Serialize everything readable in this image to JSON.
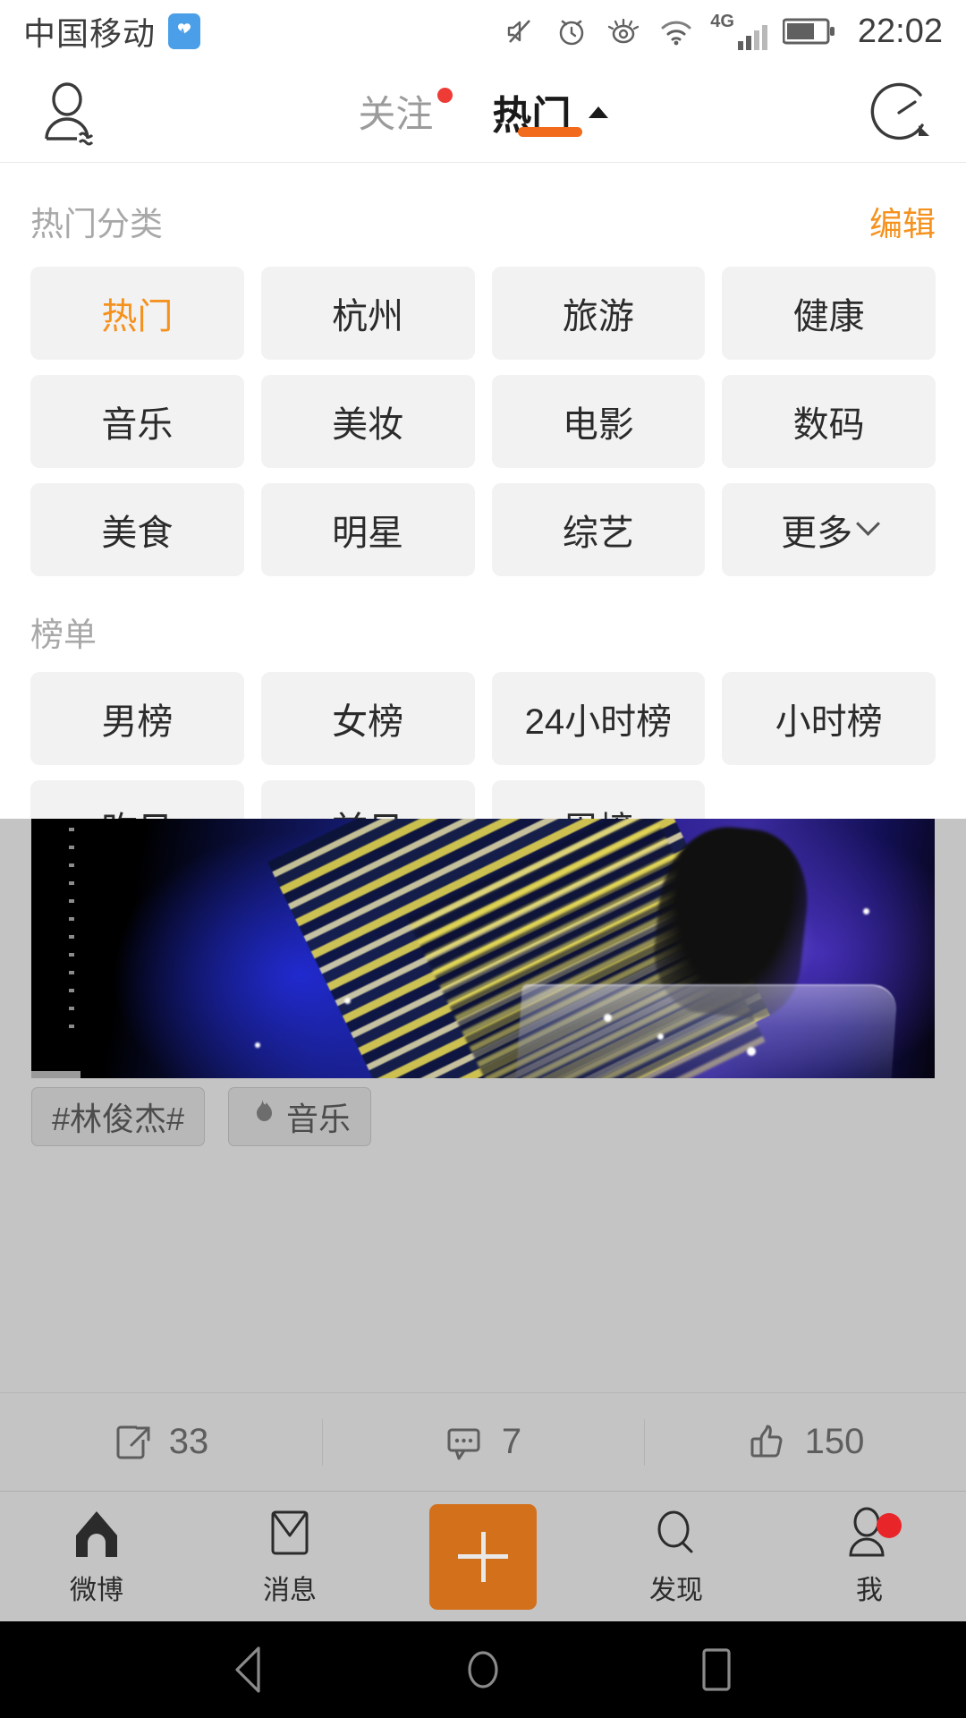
{
  "status_bar": {
    "carrier": "中国移动",
    "time": "22:02",
    "network_label": "4G",
    "icons": [
      "health-monitor-icon",
      "mute-icon",
      "alarm-clock-icon",
      "eye-comfort-icon",
      "wifi-icon",
      "signal-bars-icon",
      "battery-icon"
    ]
  },
  "top_nav": {
    "profile_icon": "user-profile-icon",
    "tabs": [
      {
        "label": "关注",
        "active": false,
        "has_dot": true
      },
      {
        "label": "热门",
        "active": true,
        "has_dot": false
      }
    ],
    "history_icon": "clock-history-icon"
  },
  "panel": {
    "category_section": {
      "title": "热门分类",
      "edit_label": "编辑",
      "chips": [
        {
          "label": "热门",
          "selected": true
        },
        {
          "label": "杭州",
          "selected": false
        },
        {
          "label": "旅游",
          "selected": false
        },
        {
          "label": "健康",
          "selected": false
        },
        {
          "label": "音乐",
          "selected": false
        },
        {
          "label": "美妆",
          "selected": false
        },
        {
          "label": "电影",
          "selected": false
        },
        {
          "label": "数码",
          "selected": false
        },
        {
          "label": "美食",
          "selected": false
        },
        {
          "label": "明星",
          "selected": false
        },
        {
          "label": "综艺",
          "selected": false
        },
        {
          "label": "更多",
          "selected": false,
          "chevron": true
        }
      ]
    },
    "ranking_section": {
      "title": "榜单",
      "chips": [
        {
          "label": "男榜"
        },
        {
          "label": "女榜"
        },
        {
          "label": "24小时榜"
        },
        {
          "label": "小时榜"
        },
        {
          "label": "昨日"
        },
        {
          "label": "前日"
        },
        {
          "label": "周榜"
        }
      ]
    }
  },
  "feed_post": {
    "tags": [
      {
        "label": "#林俊杰#",
        "icon": null
      },
      {
        "label": "音乐",
        "icon": "flame-icon"
      }
    ],
    "actions": [
      {
        "name": "repost",
        "icon": "repost-icon",
        "count": "33"
      },
      {
        "name": "comment",
        "icon": "comment-icon",
        "count": "7"
      },
      {
        "name": "like",
        "icon": "thumbs-up-icon",
        "count": "150"
      }
    ]
  },
  "tab_bar": {
    "items": [
      {
        "label": "微博",
        "icon": "home-icon"
      },
      {
        "label": "消息",
        "icon": "envelope-icon"
      },
      {
        "label": "",
        "icon": "plus-icon"
      },
      {
        "label": "发现",
        "icon": "search-icon"
      },
      {
        "label": "我",
        "icon": "person-icon",
        "badge": true
      }
    ]
  },
  "android_nav": {
    "back": "back-triangle-icon",
    "home": "home-circle-icon",
    "recents": "recents-square-icon"
  },
  "colors": {
    "accent_orange": "#f5921e",
    "tab_underline": "#f26a1b",
    "compose_button": "#d2701b",
    "badge_red": "#e8262a",
    "chip_bg": "#f2f2f2"
  }
}
